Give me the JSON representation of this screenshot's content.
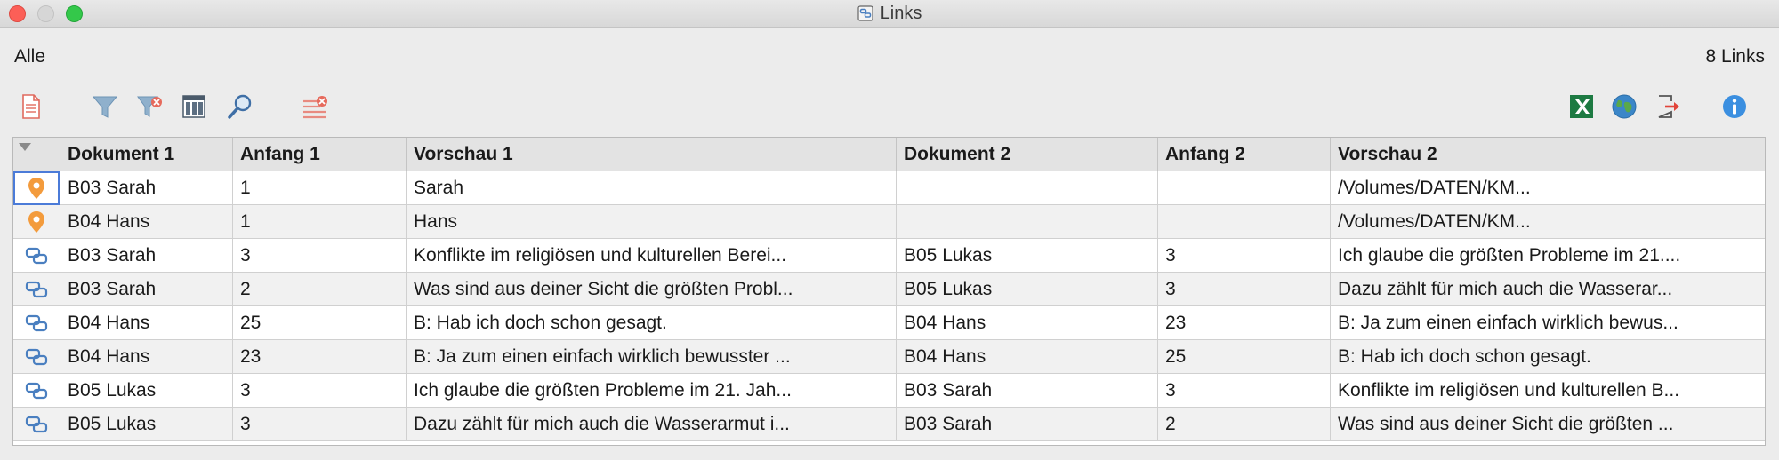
{
  "window": {
    "title": "Links"
  },
  "header": {
    "scope": "Alle",
    "count": "8 Links"
  },
  "toolbar": {
    "left": [
      "new-document-icon",
      "filter-icon",
      "clear-filter-icon",
      "columns-icon",
      "search-icon",
      "delete-rows-icon"
    ],
    "right": [
      "excel-export-icon",
      "web-export-icon",
      "export-icon",
      "info-icon"
    ]
  },
  "table": {
    "columns": [
      "Dokument 1",
      "Anfang 1",
      "Vorschau 1",
      "Dokument 2",
      "Anfang 2",
      "Vorschau 2"
    ],
    "rows": [
      {
        "icon": "pin",
        "doc1": "B03 Sarah",
        "start1": "1",
        "prev1": "Sarah",
        "doc2": "",
        "start2": "",
        "prev2": "/Volumes/DATEN/KM..."
      },
      {
        "icon": "pin",
        "doc1": "B04 Hans",
        "start1": "1",
        "prev1": "Hans",
        "doc2": "",
        "start2": "",
        "prev2": "/Volumes/DATEN/KM..."
      },
      {
        "icon": "link",
        "doc1": "B03 Sarah",
        "start1": "3",
        "prev1": "Konflikte im religiösen und kulturellen Berei...",
        "doc2": "B05 Lukas",
        "start2": "3",
        "prev2": "Ich glaube die größten Probleme im 21...."
      },
      {
        "icon": "link",
        "doc1": "B03 Sarah",
        "start1": "2",
        "prev1": "Was sind aus deiner Sicht die größten Probl...",
        "doc2": "B05 Lukas",
        "start2": "3",
        "prev2": "Dazu zählt für mich auch die Wasserar..."
      },
      {
        "icon": "link",
        "doc1": "B04 Hans",
        "start1": "25",
        "prev1": "B: Hab ich doch schon gesagt.",
        "doc2": "B04 Hans",
        "start2": "23",
        "prev2": "B: Ja zum einen einfach wirklich bewus..."
      },
      {
        "icon": "link",
        "doc1": "B04 Hans",
        "start1": "23",
        "prev1": "B: Ja zum einen einfach wirklich bewusster ...",
        "doc2": "B04 Hans",
        "start2": "25",
        "prev2": "B: Hab ich doch schon gesagt."
      },
      {
        "icon": "link",
        "doc1": "B05 Lukas",
        "start1": "3",
        "prev1": "Ich glaube die größten Probleme im 21. Jah...",
        "doc2": "B03 Sarah",
        "start2": "3",
        "prev2": "Konflikte im religiösen und kulturellen B..."
      },
      {
        "icon": "link",
        "doc1": "B05 Lukas",
        "start1": "3",
        "prev1": "Dazu zählt für mich auch die Wasserarmut i...",
        "doc2": "B03 Sarah",
        "start2": "2",
        "prev2": "Was sind aus deiner Sicht die größten ..."
      }
    ]
  },
  "colors": {
    "pin": "#f39b3c",
    "link": "#4a7fc0",
    "accent": "#3b7fd6"
  }
}
